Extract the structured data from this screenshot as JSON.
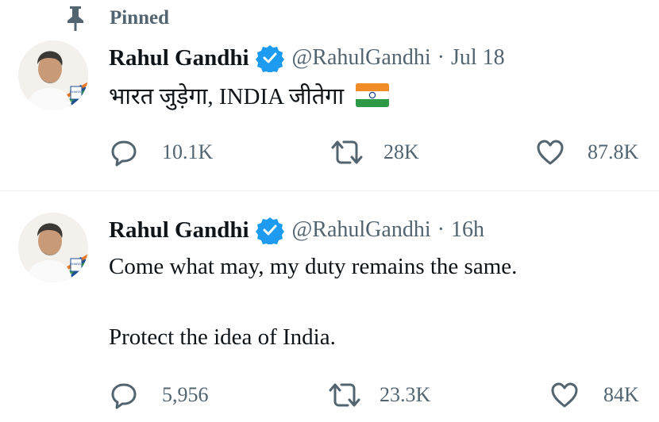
{
  "tweets": [
    {
      "pinned_label": "Pinned",
      "author": "Rahul Gandhi",
      "handle": "@RahulGandhi",
      "separator": "·",
      "time": "Jul 18",
      "text": "भारत जुड़ेगा, INDIA जीतेगा",
      "has_flag_emoji": true,
      "replies": "10.1K",
      "retweets": "28K",
      "likes": "87.8K"
    },
    {
      "author": "Rahul Gandhi",
      "handle": "@RahulGandhi",
      "separator": "·",
      "time": "16h",
      "text_line1": "Come what may, my duty remains the same.",
      "text_line2": "Protect the idea of India.",
      "replies": "5,956",
      "retweets": "23.3K",
      "likes": "84K"
    }
  ],
  "colors": {
    "text": "#0f1419",
    "secondary": "#536471",
    "verified": "#1d9bf0",
    "divider": "#eff3f4"
  },
  "icons": [
    "pin-icon",
    "verified-badge-icon",
    "reply-icon",
    "retweet-icon",
    "like-icon",
    "india-flag-icon"
  ]
}
